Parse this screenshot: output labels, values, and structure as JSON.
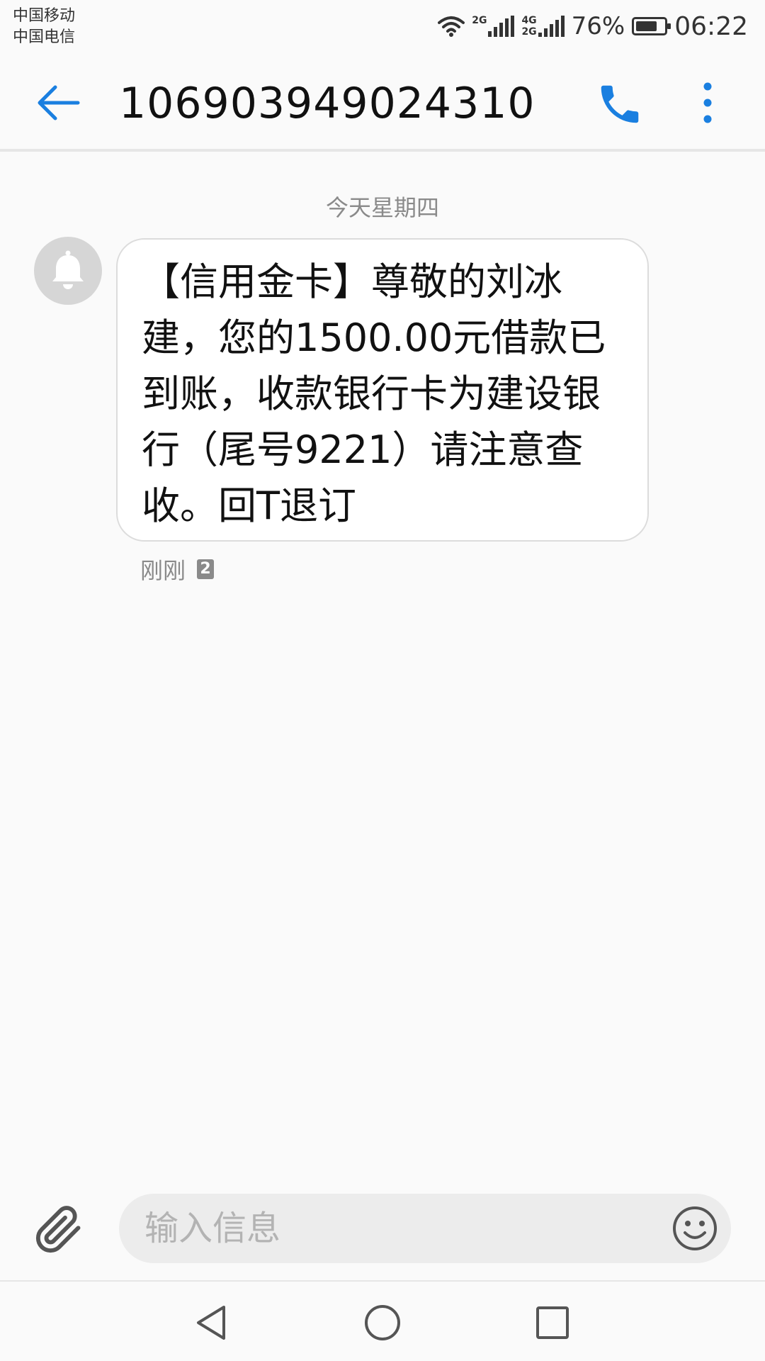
{
  "status_bar": {
    "carrier_1": "中国移动",
    "carrier_2": "中国电信",
    "net_1_label": "2G",
    "net_2_label_top": "4G",
    "net_2_label_bottom": "2G",
    "battery_percent": "76%",
    "battery_level": 0.76,
    "time": "06:22"
  },
  "app_bar": {
    "title": "106903949024310"
  },
  "conversation": {
    "date_separator": "今天星期四",
    "message": {
      "text": "【信用金卡】尊敬的刘冰建，您的1500.00元借款已到账，收款银行卡为建设银行（尾号9221）请注意查收。回T退订",
      "time": "刚刚",
      "sim_slot": "2"
    }
  },
  "composer": {
    "placeholder": "输入信息"
  },
  "colors": {
    "accent": "#1a7fe0",
    "background": "#fafafa",
    "bubble": "#ffffff",
    "avatar": "#d6d6d6",
    "muted_text": "#8a8a8a"
  },
  "icons": {
    "back": "arrow-left-icon",
    "call": "phone-icon",
    "more": "more-vertical-icon",
    "avatar": "bell-icon",
    "attach": "paperclip-icon",
    "emoji": "smiley-icon",
    "nav_back": "triangle-back-icon",
    "nav_home": "circle-home-icon",
    "nav_recents": "square-recents-icon"
  }
}
